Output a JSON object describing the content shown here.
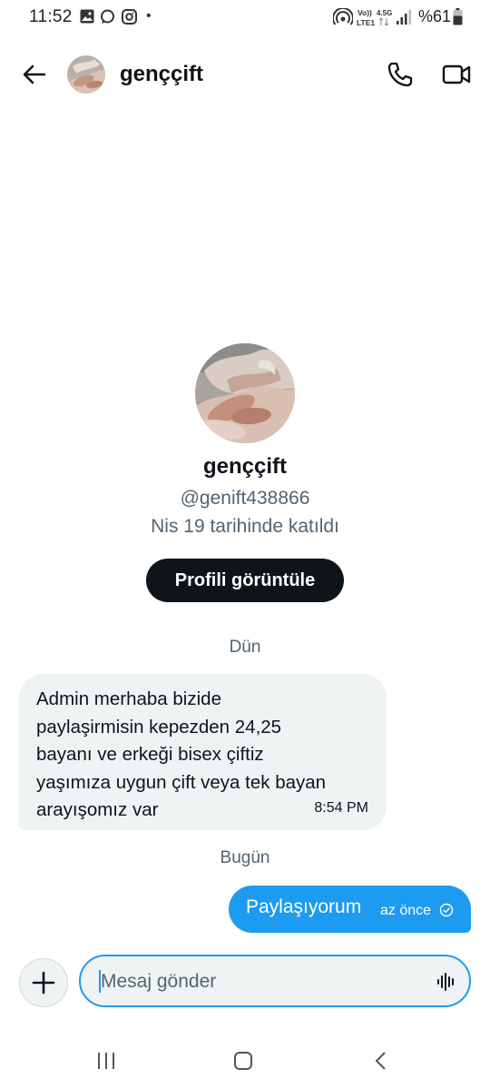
{
  "status_bar": {
    "time": "11:52",
    "dot": "•",
    "battery_text": "%61",
    "volte_label": "Vo)) LTE1",
    "network_label": "4.5G",
    "icons": [
      "gallery-icon",
      "chat-bubble-icon",
      "instagram-icon",
      "hotspot-icon",
      "signal-icon",
      "battery-icon"
    ]
  },
  "header": {
    "contact_name": "genççift",
    "icons": [
      "back-arrow-icon",
      "phone-icon",
      "video-camera-icon"
    ]
  },
  "profile": {
    "name": "genççift",
    "handle": "@genift438866",
    "joined": "Nis 19 tarihinde katıldı",
    "view_profile_label": "Profili görüntüle"
  },
  "conversation": {
    "day_yesterday": "Dün",
    "day_today": "Bugün",
    "messages": [
      {
        "direction": "incoming",
        "text": "Admin merhaba bizide\npaylaşirmisin kepezden 24,25\nbayanı  ve erkeği bisex çiftiz\nyaşımıza uygun çift veya tek bayan\narayışomız var",
        "time": "8:54 PM"
      },
      {
        "direction": "outgoing",
        "text": "Paylaşıyorum",
        "time": "az önce",
        "status_icon": "check-circle-icon"
      }
    ]
  },
  "composer": {
    "placeholder": "Mesaj gönder",
    "icons": [
      "plus-icon",
      "voice-wave-icon"
    ]
  },
  "accent_color": "#1d9bf0",
  "nav_bar": {
    "icons": [
      "recent-apps-icon",
      "home-icon",
      "back-icon"
    ]
  }
}
